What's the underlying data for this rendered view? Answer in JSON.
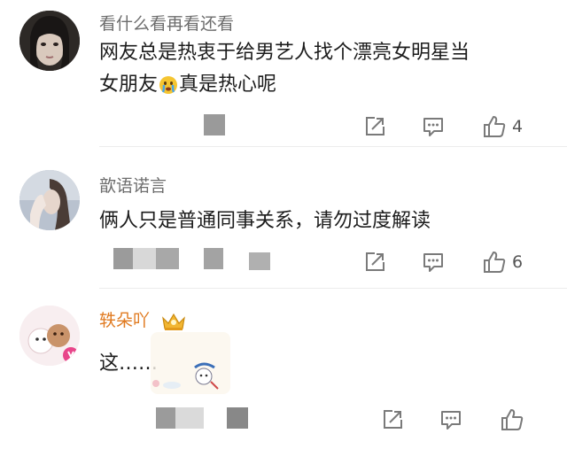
{
  "comments": [
    {
      "username": "看什么看再看还看",
      "text_line1": "网友总是热衷于给男艺人找个漂亮女明星当",
      "text_line2a": "女朋友",
      "text_line2b": "真是热心呢",
      "likes": "4"
    },
    {
      "username": "歆语诺言",
      "text": "俩人只是普通同事关系，请勿过度解读",
      "likes": "6"
    },
    {
      "username": "轶朵吖",
      "text": "这……",
      "likes": ""
    }
  ],
  "icons": {
    "share": "share-icon",
    "reply": "reply-icon",
    "like": "thumbs-up-icon",
    "emoji": "crying-emoji-icon",
    "vip_badge": "crown-badge-icon"
  },
  "colors": {
    "username": "#6d6d6d",
    "vip_username": "#e07a20",
    "icon": "#7a7a7a"
  }
}
